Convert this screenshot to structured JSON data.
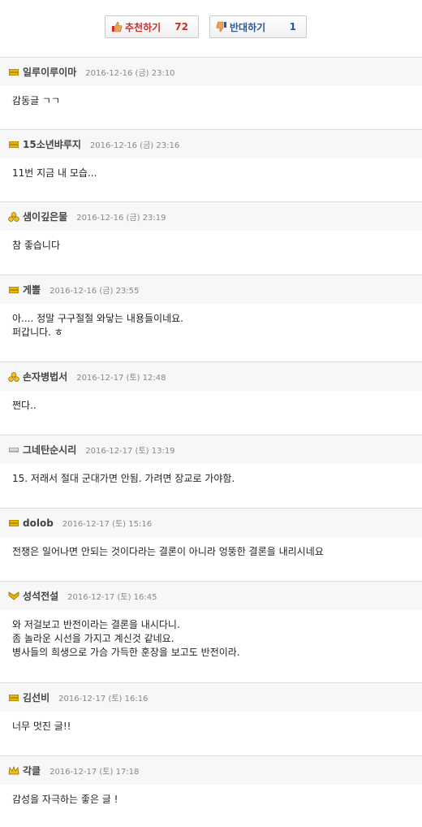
{
  "vote": {
    "up": {
      "label": "추천하기",
      "count": "72",
      "icon": "thumbs-up-icon"
    },
    "down": {
      "label": "반대하기",
      "count": "1",
      "icon": "thumbs-down-icon"
    }
  },
  "colors": {
    "up": "#c4302b",
    "down": "#2a5a9a",
    "level_gold": "#e0a800"
  },
  "comments": [
    {
      "nick": "일루이루이마",
      "date": "2016-12-16 (금) 23:10",
      "level_icon": "level-bar-icon",
      "lines": [
        "감동글 ㄱㄱ"
      ]
    },
    {
      "nick": "15소년뱌루지",
      "date": "2016-12-16 (금) 23:16",
      "level_icon": "level-bar-icon",
      "lines": [
        "11번 지금 내 모습..."
      ]
    },
    {
      "nick": "샘이깊은물",
      "date": "2016-12-16 (금) 23:19",
      "level_icon": "level-gold-icon",
      "lines": [
        "참 좋습니다"
      ]
    },
    {
      "nick": "게뽈",
      "date": "2016-12-16 (금) 23:55",
      "level_icon": "level-bar-icon",
      "lines": [
        "아.... 정말 구구절절 와닿는 내용들이네요.",
        "퍼갑니다. ㅎ"
      ]
    },
    {
      "nick": "손자병법서",
      "date": "2016-12-17 (토) 12:48",
      "level_icon": "level-gold-icon",
      "lines": [
        "쩐다.."
      ]
    },
    {
      "nick": "그네탄순시리",
      "date": "2016-12-17 (토) 13:19",
      "level_icon": "level-line-icon",
      "lines": [
        "15. 저래서 절대 군대가면 안됨. 가려면 장교로 가야함."
      ]
    },
    {
      "nick": "dolob",
      "date": "2016-12-17 (토) 15:16",
      "level_icon": "level-bar-icon",
      "lines": [
        "전쟁은 일어나면 안되는 것이다라는 결론이 아니라 엉뚱한 결론을 내리시네요"
      ]
    },
    {
      "nick": "성석전설",
      "date": "2016-12-17 (토) 16:45",
      "level_icon": "level-chevron-icon",
      "lines": [
        "와 저걸보고 반전이라는 결론을 내시다니.",
        "좀 놀라운 시선을 가지고 계신것 같네요.",
        "병사들의 희생으로 가슴 가득한 훈장을 보고도 반전이라."
      ]
    },
    {
      "nick": "김선비",
      "date": "2016-12-17 (토) 16:16",
      "level_icon": "level-bar-icon",
      "lines": [
        "너무 멋진 글!!"
      ]
    },
    {
      "nick": "각클",
      "date": "2016-12-17 (토) 17:18",
      "level_icon": "level-crown-icon",
      "lines": [
        "감성을 자극하는 좋은 글 !"
      ]
    }
  ]
}
